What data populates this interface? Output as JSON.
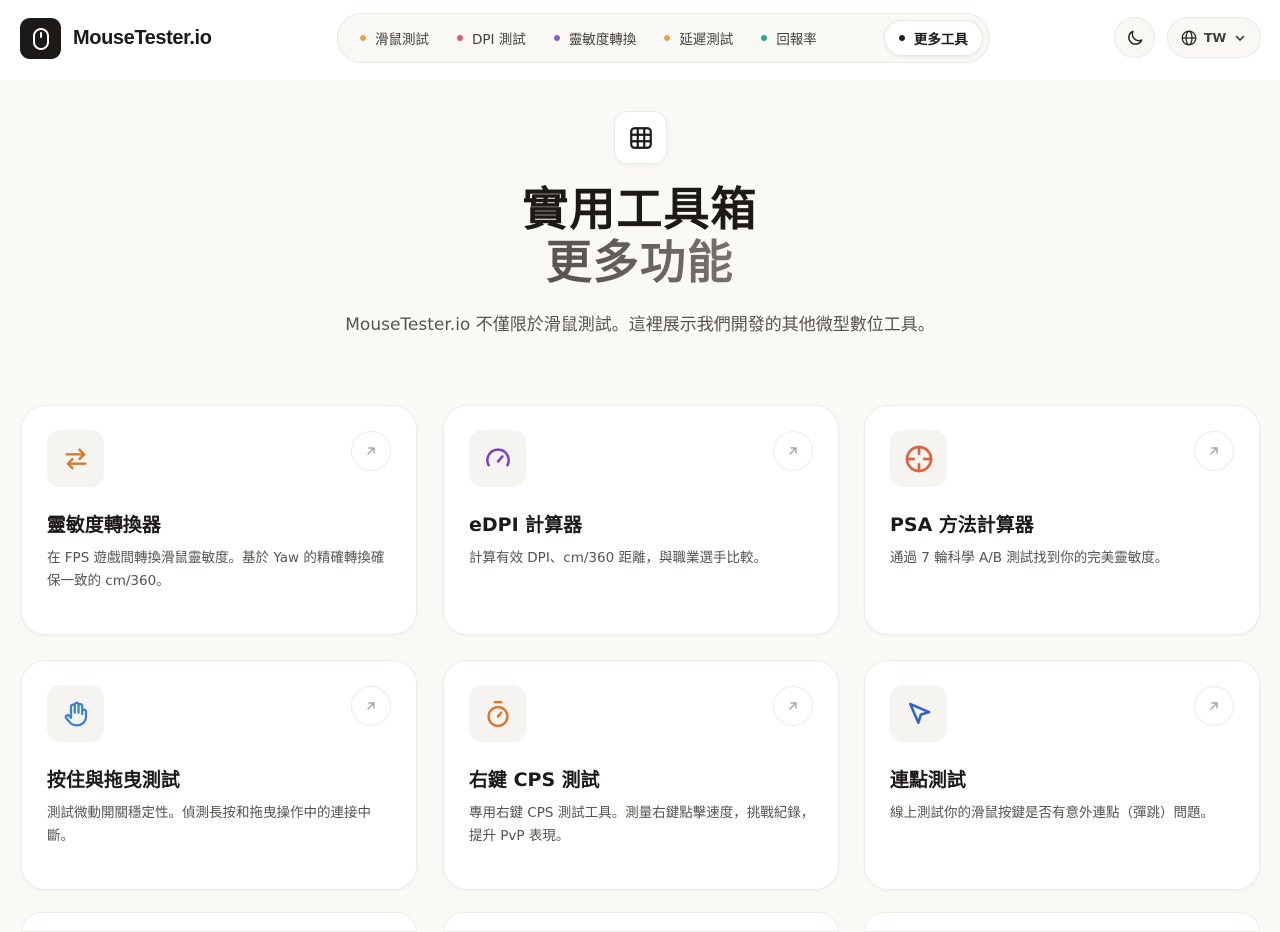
{
  "app": {
    "brand": "MouseTester.io"
  },
  "nav": {
    "items": [
      {
        "label": "滑鼠測試",
        "dot_color": "#e8a04c"
      },
      {
        "label": "DPI 測試",
        "dot_color": "#e0567a"
      },
      {
        "label": "靈敏度轉換",
        "dot_color": "#8a5cd6"
      },
      {
        "label": "延遲測試",
        "dot_color": "#e8a04c"
      },
      {
        "label": "回報率",
        "dot_color": "#1fae8c"
      },
      {
        "label": "更多工具",
        "dot_color": "#1c1917",
        "active": true
      }
    ]
  },
  "header": {
    "language_code": "TW",
    "theme_icon": "moon-icon",
    "language_icon": "globe-icon"
  },
  "hero": {
    "icon": "grid-icon",
    "title_line1": "實用工具箱",
    "title_line2": "更多功能",
    "subtitle": "MouseTester.io 不僅限於滑鼠測試。這裡展示我們開發的其他微型數位工具。"
  },
  "cards": [
    {
      "title": "靈敏度轉換器",
      "description": "在 FPS 遊戲間轉換滑鼠靈敏度。基於 Yaw 的精確轉換確保一致的 cm/360。",
      "icon": "swap-arrows-icon",
      "icon_color": "#d97a2b"
    },
    {
      "title": "eDPI 計算器",
      "description": "計算有效 DPI、cm/360 距離，與職業選手比較。",
      "icon": "speedometer-icon",
      "icon_color": "#7b3fd0"
    },
    {
      "title": "PSA 方法計算器",
      "description": "通過 7 輪科學 A/B 測試找到你的完美靈敏度。",
      "icon": "crosshair-icon",
      "icon_color": "#e0623a"
    },
    {
      "title": "按住與拖曳測試",
      "description": "測試微動開關穩定性。偵測長按和拖曳操作中的連接中斷。",
      "icon": "hand-icon",
      "icon_color": "#3b7fd6"
    },
    {
      "title": "右鍵 CPS 測試",
      "description": "專用右鍵 CPS 測試工具。測量右鍵點擊速度，挑戰紀錄，提升 PvP 表現。",
      "icon": "stopwatch-icon",
      "icon_color": "#d97a2b"
    },
    {
      "title": "連點測試",
      "description": "線上測試你的滑鼠按鍵是否有意外連點（彈跳）問題。",
      "icon": "cursor-arrow-icon",
      "icon_color": "#2f5fd0"
    }
  ]
}
